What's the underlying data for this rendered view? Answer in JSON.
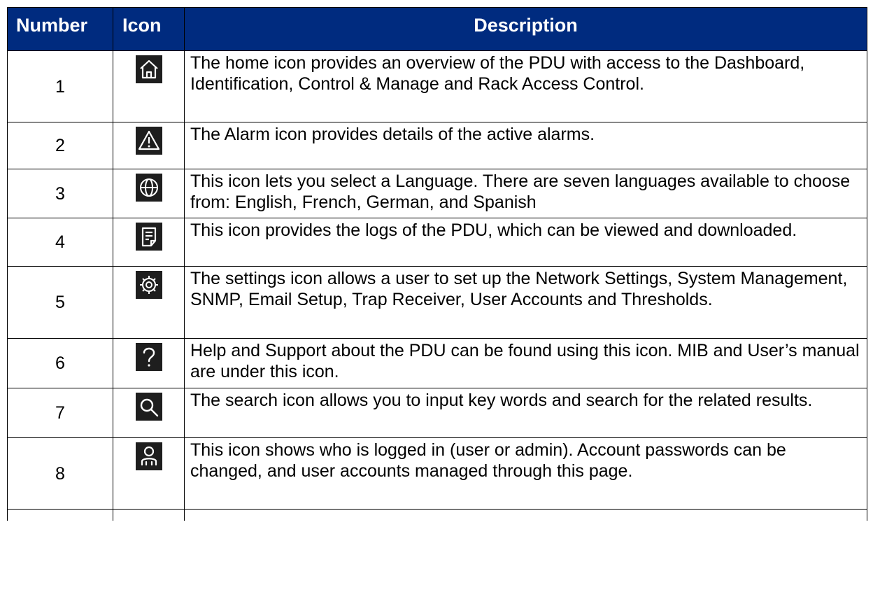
{
  "table": {
    "headers": {
      "number": "Number",
      "icon": "Icon",
      "description": "Description"
    },
    "rows": [
      {
        "number": "1",
        "icon": "home-icon",
        "description": "The home icon provides an overview of the PDU with access to the Dashboard, Identification, Control & Manage and Rack Access Control."
      },
      {
        "number": "2",
        "icon": "alarm-icon",
        "description": "The Alarm icon provides details of the active alarms."
      },
      {
        "number": "3",
        "icon": "globe-icon",
        "description": "This icon lets you select a Language. There are seven languages available to choose from: English, French, German, and Spanish"
      },
      {
        "number": "4",
        "icon": "logs-icon",
        "description": "This icon provides the logs of the PDU, which can be viewed and downloaded."
      },
      {
        "number": "5",
        "icon": "settings-icon",
        "description": "The settings icon allows a user to set up the Network Settings, System Management, SNMP, Email Setup, Trap Receiver, User Accounts and Thresholds."
      },
      {
        "number": "6",
        "icon": "help-icon",
        "description": "Help and Support about the PDU can be found using this icon. MIB and User’s manual are under this icon."
      },
      {
        "number": "7",
        "icon": "search-icon",
        "description": "The search icon allows you to input key words and search for the related results."
      },
      {
        "number": "8",
        "icon": "user-icon",
        "description": "This icon shows who is logged in (user or admin). Account passwords can be changed, and user accounts managed through this page."
      }
    ]
  },
  "colors": {
    "header_bg": "#002b7f",
    "header_text": "#ffffff",
    "icon_bg": "#1e1e1e",
    "icon_stroke": "#ffffff"
  }
}
